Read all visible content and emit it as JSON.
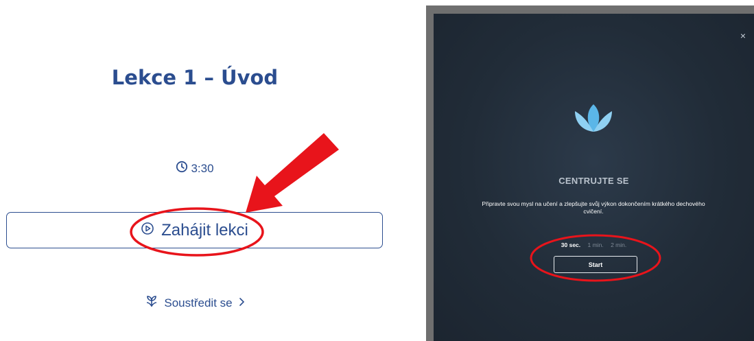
{
  "lesson": {
    "title": "Lekce 1 – Úvod",
    "duration": "3:30",
    "start_label": "Zahájit lekci",
    "focus_label": "Soustředit se"
  },
  "modal": {
    "close_icon": "×",
    "title": "CENTRUJTE SE",
    "description": "Připravte svou mysl na učení a zlepšujte svůj výkon dokončením krátkého dechového cvičení.",
    "durations": [
      "30 sec.",
      "1 min.",
      "2 min."
    ],
    "selected_duration": "30 sec.",
    "start_label": "Start"
  },
  "colors": {
    "brand_blue": "#2b4d8f",
    "modal_bg": "#212c38",
    "lotus": "#5bb6e8",
    "annotation_red": "#e8141b"
  },
  "icons": [
    "clock-icon",
    "play-circle-icon",
    "sprout-icon",
    "chevron-right-icon",
    "close-icon",
    "lotus-icon"
  ]
}
